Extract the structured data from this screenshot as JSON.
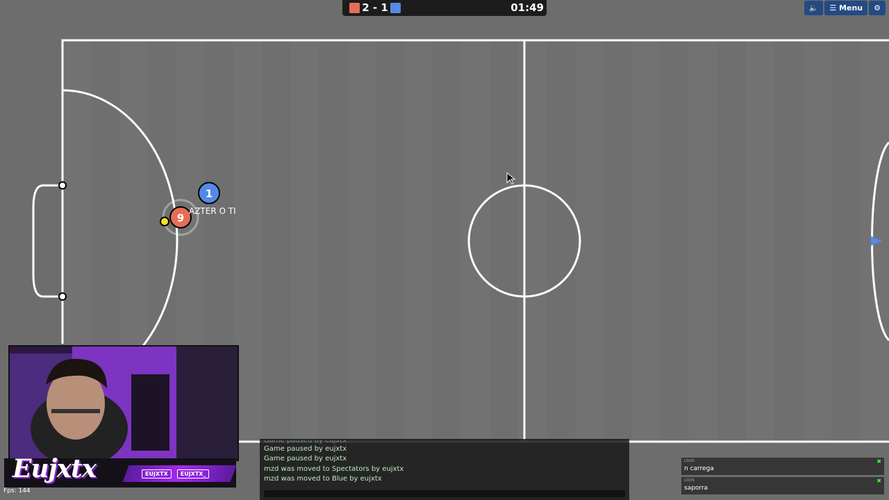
{
  "scoreboard": {
    "red_score": "2",
    "separator": "-",
    "blue_score": "1",
    "clock": "01:49",
    "red_color": "#e56e56",
    "blue_color": "#5689e5"
  },
  "top_menu": {
    "sound_icon": "speaker-icon",
    "menu_label": "Menu",
    "menu_icon": "hamburger-icon",
    "settings_icon": "gear-icon"
  },
  "players": [
    {
      "number": "1",
      "team": "blue",
      "name": "",
      "color": "#5689e5"
    },
    {
      "number": "9",
      "team": "red",
      "name": "AZTER O TI",
      "color": "#e56e56"
    }
  ],
  "ball": {
    "color": "#f2e41c"
  },
  "streamer": {
    "brand": "Eujxtx",
    "handle1": "EUJXTX",
    "handle2": "EUJXTX_",
    "fps": "Fps: 144"
  },
  "chat": {
    "messages": [
      "Game paused by eujxtx",
      "Game paused by eujxtx",
      "Game paused by eujxtx",
      "mzd was moved to Spectators by eujxtx",
      "mzd was moved to Blue by eujxtx"
    ]
  },
  "right_list": [
    {
      "label": "LOUIS",
      "name": "n carrega"
    },
    {
      "label": "LOUIS",
      "name": "saporra"
    }
  ]
}
